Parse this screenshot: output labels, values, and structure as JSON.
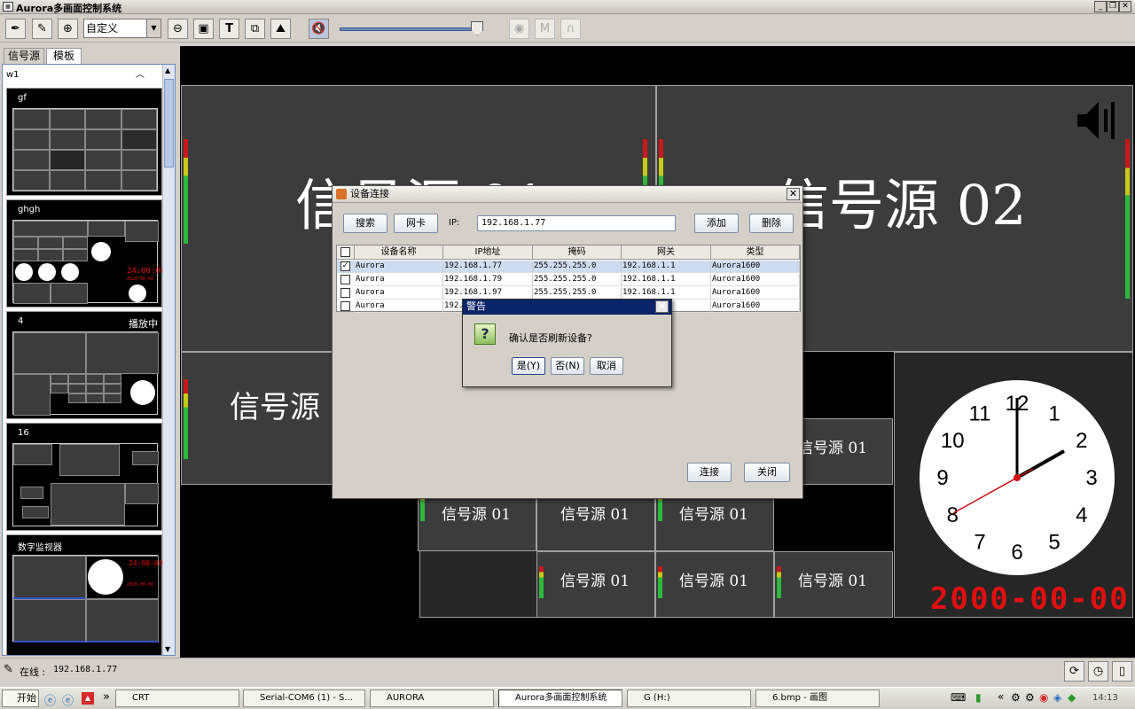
{
  "window": {
    "title": "Aurora多画面控制系统"
  },
  "toolbar": {
    "zoom_value": "自定义",
    "buttons": [
      "pen-icon",
      "pipette-icon",
      "zoom-in-icon",
      "zoom-out-icon",
      "fit-icon",
      "text-icon",
      "copy-icon",
      "image-icon",
      "mute-icon"
    ]
  },
  "left_panel": {
    "tabs": [
      "信号源",
      "模板"
    ],
    "header": "w1",
    "templates": [
      {
        "name": "gf",
        "badge": ""
      },
      {
        "name": "ghgh",
        "badge": ""
      },
      {
        "name": "4",
        "badge": "播放中"
      },
      {
        "name": "16",
        "badge": ""
      },
      {
        "name": "数字监视器",
        "badge": ""
      }
    ],
    "digital_time": "24:00:00",
    "digital_date": "2020-00-00"
  },
  "canvas": {
    "large_sources": [
      "信号源 01",
      "信号源 02"
    ],
    "mid_source": "信号源",
    "small_sources": [
      "信号源 01",
      "信号源 01",
      "信号源 01",
      "信号源 01",
      "信号源 01",
      "信号源 01",
      "信号源 01"
    ],
    "clock_numbers": [
      "12",
      "1",
      "2",
      "3",
      "4",
      "5",
      "6",
      "7",
      "8",
      "9",
      "10",
      "11"
    ],
    "date_readout": "2000-00-00"
  },
  "device_dialog": {
    "title": "设备连接",
    "search_label": "搜索",
    "nic_label": "网卡",
    "ip_label": "IP:",
    "ip_value": "192.168.1.77",
    "add_label": "添加",
    "delete_label": "删除",
    "columns": [
      "设备名称",
      "IP地址",
      "掩码",
      "网关",
      "类型"
    ],
    "rows": [
      {
        "checked": true,
        "name": "Aurora",
        "ip": "192.168.1.77",
        "mask": "255.255.255.0",
        "gateway": "192.168.1.1",
        "type": "Aurora1600"
      },
      {
        "checked": false,
        "name": "Aurora",
        "ip": "192.168.1.79",
        "mask": "255.255.255.0",
        "gateway": "192.168.1.1",
        "type": "Aurora1600"
      },
      {
        "checked": false,
        "name": "Aurora",
        "ip": "192.168.1.97",
        "mask": "255.255.255.0",
        "gateway": "192.168.1.1",
        "type": "Aurora1600"
      },
      {
        "checked": false,
        "name": "Aurora",
        "ip": "192.",
        "mask": "",
        "gateway": "",
        "type": "Aurora1600"
      }
    ],
    "connect_label": "连接",
    "close_label": "关闭"
  },
  "warning_dialog": {
    "title": "警告",
    "message": "确认是否刷新设备?",
    "yes_label": "是(Y)",
    "no_label": "否(N)",
    "cancel_label": "取消"
  },
  "status": {
    "label": "在线 :",
    "ip": "192.168.1.77"
  },
  "taskbar": {
    "start_label": "开始",
    "chevron": "»",
    "tasks": [
      "CRT",
      "Serial-COM6 (1) - S...",
      "AURORA",
      "Aurora多画面控制系统",
      "G (H:)",
      "6.bmp - 画图"
    ],
    "tray_chevron": "«",
    "clock": "14:13"
  },
  "colors": {
    "titlebar_dialog": "#0a246a",
    "meter_red": "#c81818",
    "meter_green": "#2db83b",
    "date_red": "#e01010"
  }
}
